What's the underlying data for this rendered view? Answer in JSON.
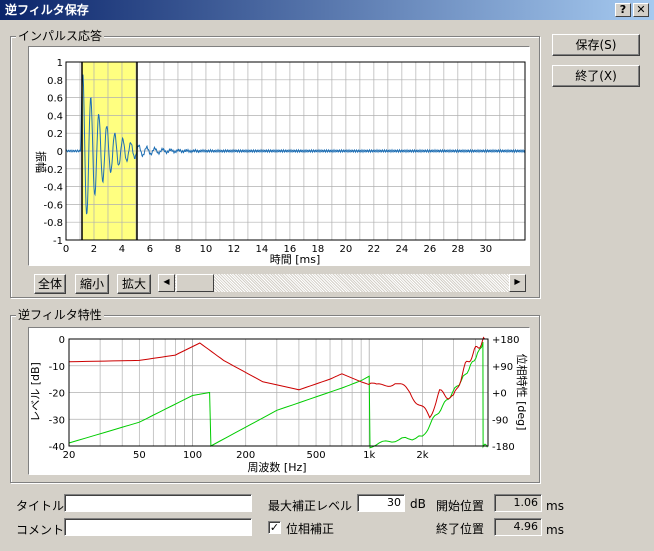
{
  "window": {
    "title": "逆フィルタ保存",
    "help_label": "?",
    "close_label": "✕"
  },
  "buttons": {
    "save": "保存(S)",
    "exit": "終了(X)"
  },
  "impulse": {
    "group_label": "インパルス応答",
    "y_label": "振幅",
    "x_label": "時間 [ms]",
    "y_ticks": [
      "1",
      "0.8",
      "0.6",
      "0.4",
      "0.2",
      "0",
      "-0.2",
      "-0.4",
      "-0.6",
      "-0.8",
      "-1"
    ],
    "x_ticks": [
      "0",
      "2",
      "4",
      "6",
      "8",
      "10",
      "12",
      "14",
      "16",
      "18",
      "20",
      "22",
      "24",
      "26",
      "28",
      "30"
    ],
    "buttons": {
      "all": "全体",
      "shrink": "縮小",
      "expand": "拡大"
    },
    "highlight_color": "#ffff80",
    "trace_color": "#1f6fb4"
  },
  "filter": {
    "group_label": "逆フィルタ特性",
    "y_label_left": "レベル [dB]",
    "y_label_right": "位相特性 [deg]",
    "x_label": "周波数 [Hz]",
    "y_ticks_left": [
      "0",
      "-10",
      "-20",
      "-30",
      "-40"
    ],
    "y_ticks_right": [
      "+180",
      "+90",
      "+0",
      "-90",
      "-180"
    ],
    "x_ticks": [
      "20",
      "50",
      "100",
      "200",
      "500",
      "1k",
      "2k"
    ],
    "level_color": "#cc0000",
    "phase_color": "#00cc00"
  },
  "form": {
    "title_label": "タイトル",
    "title_value": "",
    "comment_label": "コメント",
    "comment_value": "",
    "max_level_label": "最大補正レベル",
    "max_level_value": "30",
    "max_level_unit": "dB",
    "phase_check_label": "位相補正",
    "phase_check_mark": "✓",
    "start_label": "開始位置",
    "start_value": "1.06",
    "start_unit": "ms",
    "end_label": "終了位置",
    "end_value": "4.96",
    "end_unit": "ms"
  }
}
